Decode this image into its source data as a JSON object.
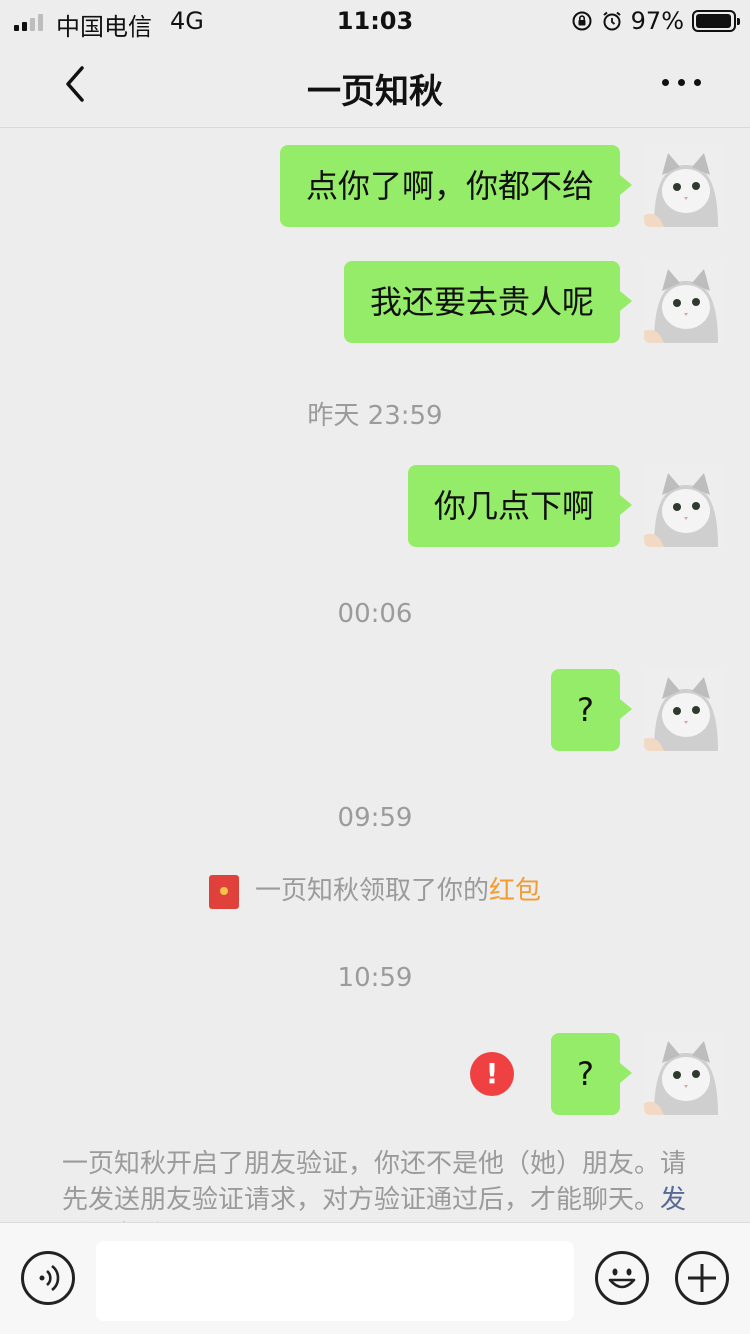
{
  "status_bar": {
    "carrier": "中国电信",
    "network": "4G",
    "time": "11:03",
    "battery": "97%",
    "battery_level": 0.97
  },
  "header": {
    "back_icon": "chevron-left-icon",
    "title": "一页知秋",
    "more_icon": "more-dots-icon"
  },
  "messages": [
    {
      "text": "点你了啊，你都不给"
    },
    {
      "text": "我还要去贵人呢"
    },
    {
      "text": "你几点下啊"
    },
    {
      "text": "?"
    },
    {
      "text": "?"
    }
  ],
  "timestamps": [
    "昨天 23:59",
    "00:06",
    "09:59",
    "10:59"
  ],
  "red_packet_notice": {
    "prefix": "一页知秋领取了你的",
    "link": "红包"
  },
  "failed_icon": "!",
  "friend_verification_notice": {
    "text": "一页知秋开启了朋友验证，你还不是他（她）朋友。请先发送朋友验证请求，对方验证通过后，才能聊天。",
    "link": "发送朋友验证"
  },
  "input_bar": {
    "voice_icon": "voice-icon",
    "text_value": "",
    "emoji_icon": "emoji-icon",
    "plus_icon": "plus-icon"
  },
  "colors": {
    "bubble": "#95ec69",
    "background": "#ededed",
    "error": "#f04142",
    "red_packet_link": "#f39c33",
    "link": "#576b95"
  }
}
